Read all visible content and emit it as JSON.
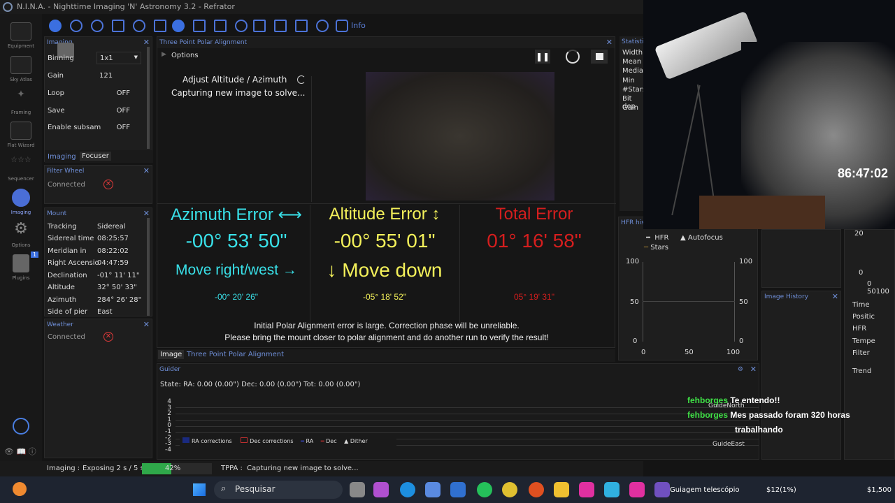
{
  "window": {
    "title": "N.I.N.A. - Nighttime Imaging 'N' Astronomy 3.2  -  Refrator"
  },
  "sidebar": {
    "items": [
      {
        "label": "Equipment",
        "icon": "telescope-icon"
      },
      {
        "label": "Sky Atlas",
        "icon": "sky-atlas-icon"
      },
      {
        "label": "Framing",
        "icon": "framing-icon"
      },
      {
        "label": "Flat Wizard",
        "icon": "flat-wizard-icon"
      },
      {
        "label": "Sequencer",
        "icon": "sequencer-icon"
      },
      {
        "label": "Imaging",
        "icon": "imaging-icon"
      },
      {
        "label": "Options",
        "icon": "gear-icon"
      },
      {
        "label": "Plugins",
        "icon": "puzzle-icon",
        "badge": "1"
      }
    ]
  },
  "toolbar": {
    "info_label": "Info"
  },
  "imaging_panel": {
    "title": "Imaging",
    "rows": [
      {
        "label": "Binning",
        "value": "1x1"
      },
      {
        "label": "Gain",
        "value": "121"
      },
      {
        "label": "Loop",
        "value": "OFF"
      },
      {
        "label": "Save",
        "value": "OFF"
      },
      {
        "label": "Enable subsam",
        "value": "OFF"
      }
    ],
    "tabs": [
      "Imaging",
      "Focuser"
    ]
  },
  "filter_wheel": {
    "title": "Filter Wheel",
    "status": "Connected"
  },
  "mount": {
    "title": "Mount",
    "rows": [
      {
        "label": "Tracking",
        "value": "Sidereal"
      },
      {
        "label": "Sidereal time",
        "value": "08:25:57"
      },
      {
        "label": "Meridian in",
        "value": "08:22:02"
      },
      {
        "label": "Right Ascensio",
        "value": "04:47:59"
      },
      {
        "label": "Declination",
        "value": "-01° 11' 11\""
      },
      {
        "label": "Altitude",
        "value": "32° 50' 33\""
      },
      {
        "label": "Azimuth",
        "value": "284° 26' 28\""
      },
      {
        "label": "Side of pier",
        "value": "East"
      }
    ]
  },
  "weather": {
    "title": "Weather",
    "status": "Connected"
  },
  "tppa": {
    "title": "Three Point Polar Alignment",
    "options_label": "Options",
    "step_title": "Adjust Altitude / Azimuth",
    "step_status": "Capturing new image to solve...",
    "azimuth": {
      "label": "Azimuth Error ⟷",
      "value": "-00° 53' 50\"",
      "move": "Move right/west →",
      "small": "-00° 20' 26\""
    },
    "altitude": {
      "label": "Altitude Error ↕",
      "value": "-00° 55' 01\"",
      "move": "↓ Move down",
      "small": "-05° 18' 52\""
    },
    "total": {
      "label": "Total Error",
      "value": "01° 16' 58\"",
      "small": "05° 19' 31\""
    },
    "warning1": "Initial Polar Alignment error is large. Correction phase will be unreliable.",
    "warning2": "Please bring the mount closer to polar alignment and do another run to verify the result!",
    "tabs": [
      "Image",
      "Three Point Polar Alignment"
    ]
  },
  "statistics": {
    "title": "Statistics",
    "labels": [
      "Width",
      "Mean",
      "Media",
      "Min",
      "#Stars",
      "Bit dep",
      "Gain"
    ]
  },
  "hfr": {
    "title": "HFR histo",
    "legend": [
      "HFR",
      "Autofocus",
      "Stars"
    ],
    "y_ticks": [
      "100",
      "50",
      "0"
    ],
    "x_ticks": [
      "0",
      "50",
      "100"
    ]
  },
  "image_history": {
    "title": "Image History"
  },
  "right_list": {
    "labels": [
      "Time",
      "Positic",
      "HFR",
      "Tempe",
      "Filter",
      "Trend"
    ],
    "ticks": [
      "20",
      "0",
      "0 50100"
    ]
  },
  "guider": {
    "title": "Guider",
    "state": "State:  RA: 0.00 (0.00\")  Dec: 0.00 (0.00\")  Tot: 0.00 (0.00\")",
    "y_ticks": [
      "4",
      "3",
      "2",
      "1",
      "0",
      "-1",
      "-2",
      "-3",
      "-4"
    ],
    "legend": [
      "RA corrections",
      "Dec corrections",
      "RA",
      "Dec",
      "Dither"
    ],
    "north": "GuideNorth",
    "east": "GuideEast"
  },
  "statusbar": {
    "imaging_label": "Imaging :",
    "imaging_text": "Exposing 2 s / 5 s",
    "progress_text": "42%",
    "progress": 0.42,
    "tppa_label": "TPPA :",
    "tppa_text": "Capturing new image to solve..."
  },
  "webcam": {
    "timer": "86:47:02"
  },
  "chat": [
    {
      "user": "fehborges",
      "msg": "Te entendo!!"
    },
    {
      "user": "fehborges",
      "msg": "Mes passado foram 320 horas"
    },
    {
      "user": "",
      "msg": "trabalhando"
    }
  ],
  "taskbar": {
    "search": "Pesquisar",
    "notif": "Guiagem telescópio",
    "stock": "$12(1%)",
    "price": "$1,500"
  }
}
